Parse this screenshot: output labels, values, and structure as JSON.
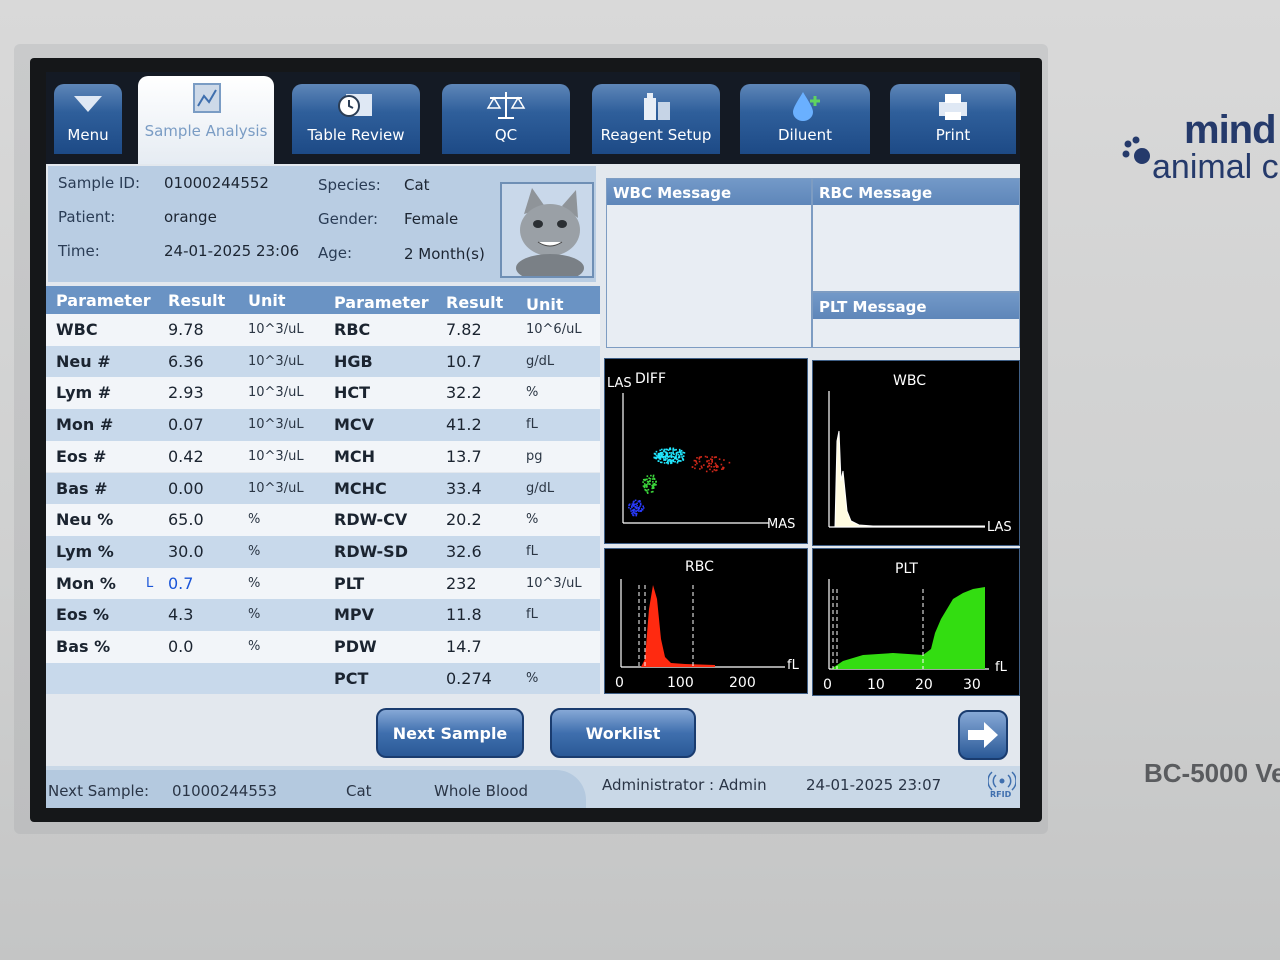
{
  "tabs": [
    {
      "label": "Menu",
      "icon": "menu-down-triangle-icon"
    },
    {
      "label": "Sample Analysis",
      "icon": "chart-document-icon"
    },
    {
      "label": "Table Review",
      "icon": "clock-table-icon"
    },
    {
      "label": "QC",
      "icon": "balance-scale-icon"
    },
    {
      "label": "Reagent Setup",
      "icon": "reagent-bottles-icon"
    },
    {
      "label": "Diluent",
      "icon": "droplet-plus-icon"
    },
    {
      "label": "Print",
      "icon": "printer-icon"
    }
  ],
  "sample": {
    "id_label": "Sample ID:",
    "id": "01000244552",
    "patient_label": "Patient:",
    "patient": "orange",
    "time_label": "Time:",
    "time": "24-01-2025 23:06",
    "species_label": "Species:",
    "species": "Cat",
    "gender_label": "Gender:",
    "gender": "Female",
    "age_label": "Age:",
    "age": "2 Month(s)"
  },
  "table": {
    "headers": [
      "Parameter",
      "Result",
      "Unit",
      "Parameter",
      "Result",
      "Unit"
    ],
    "rows": [
      {
        "p1": "WBC",
        "r1": "9.78",
        "f1": "",
        "u1": "10^3/uL",
        "p2": "RBC",
        "r2": "7.82",
        "u2": "10^6/uL"
      },
      {
        "p1": "Neu #",
        "r1": "6.36",
        "f1": "",
        "u1": "10^3/uL",
        "p2": "HGB",
        "r2": "10.7",
        "u2": "g/dL"
      },
      {
        "p1": "Lym #",
        "r1": "2.93",
        "f1": "",
        "u1": "10^3/uL",
        "p2": "HCT",
        "r2": "32.2",
        "u2": "%"
      },
      {
        "p1": "Mon #",
        "r1": "0.07",
        "f1": "",
        "u1": "10^3/uL",
        "p2": "MCV",
        "r2": "41.2",
        "u2": "fL"
      },
      {
        "p1": "Eos #",
        "r1": "0.42",
        "f1": "",
        "u1": "10^3/uL",
        "p2": "MCH",
        "r2": "13.7",
        "u2": "pg"
      },
      {
        "p1": "Bas #",
        "r1": "0.00",
        "f1": "",
        "u1": "10^3/uL",
        "p2": "MCHC",
        "r2": "33.4",
        "u2": "g/dL"
      },
      {
        "p1": "Neu %",
        "r1": "65.0",
        "f1": "",
        "u1": "%",
        "p2": "RDW-CV",
        "r2": "20.2",
        "u2": "%"
      },
      {
        "p1": "Lym %",
        "r1": "30.0",
        "f1": "",
        "u1": "%",
        "p2": "RDW-SD",
        "r2": "32.6",
        "u2": "fL"
      },
      {
        "p1": "Mon %",
        "r1": "0.7",
        "f1": "L",
        "u1": "%",
        "p2": "PLT",
        "r2": "232",
        "u2": "10^3/uL"
      },
      {
        "p1": "Eos %",
        "r1": "4.3",
        "f1": "",
        "u1": "%",
        "p2": "MPV",
        "r2": "11.8",
        "u2": "fL"
      },
      {
        "p1": "Bas %",
        "r1": "0.0",
        "f1": "",
        "u1": "%",
        "p2": "PDW",
        "r2": "14.7",
        "u2": ""
      },
      {
        "p1": "",
        "r1": "",
        "f1": "",
        "u1": "",
        "p2": "PCT",
        "r2": "0.274",
        "u2": "%"
      }
    ]
  },
  "messages": {
    "wbc": "WBC Message",
    "rbc": "RBC Message",
    "plt": "PLT Message"
  },
  "graphs": {
    "diff": {
      "title": "DIFF",
      "ylabel": "LAS",
      "xlabel": "MAS"
    },
    "wbc": {
      "title": "WBC",
      "xlabel": "LAS"
    },
    "rbc": {
      "title": "RBC",
      "unit": "fL",
      "ticks": [
        "0",
        "100",
        "200"
      ]
    },
    "plt": {
      "title": "PLT",
      "unit": "fL",
      "ticks": [
        "0",
        "10",
        "20",
        "30"
      ]
    }
  },
  "buttons": {
    "next": "Next Sample",
    "worklist": "Worklist"
  },
  "status": {
    "next_label": "Next Sample:",
    "next_id": "01000244553",
    "species": "Cat",
    "sample_type": "Whole Blood",
    "user": "Administrator : Admin",
    "datetime": "24-01-2025 23:07",
    "rfid": "RFID"
  },
  "device": {
    "brand_top": "mind",
    "brand_sub": "animal c",
    "model": "BC-5000 Ve"
  },
  "colors": {
    "tab_blue": "#2f5f9b",
    "table_head": "#6a93c4",
    "rbc_curve": "#ff2a10",
    "plt_curve": "#33dd11",
    "flag_low": "#1a55d8",
    "result_low": "#1a55d8"
  }
}
